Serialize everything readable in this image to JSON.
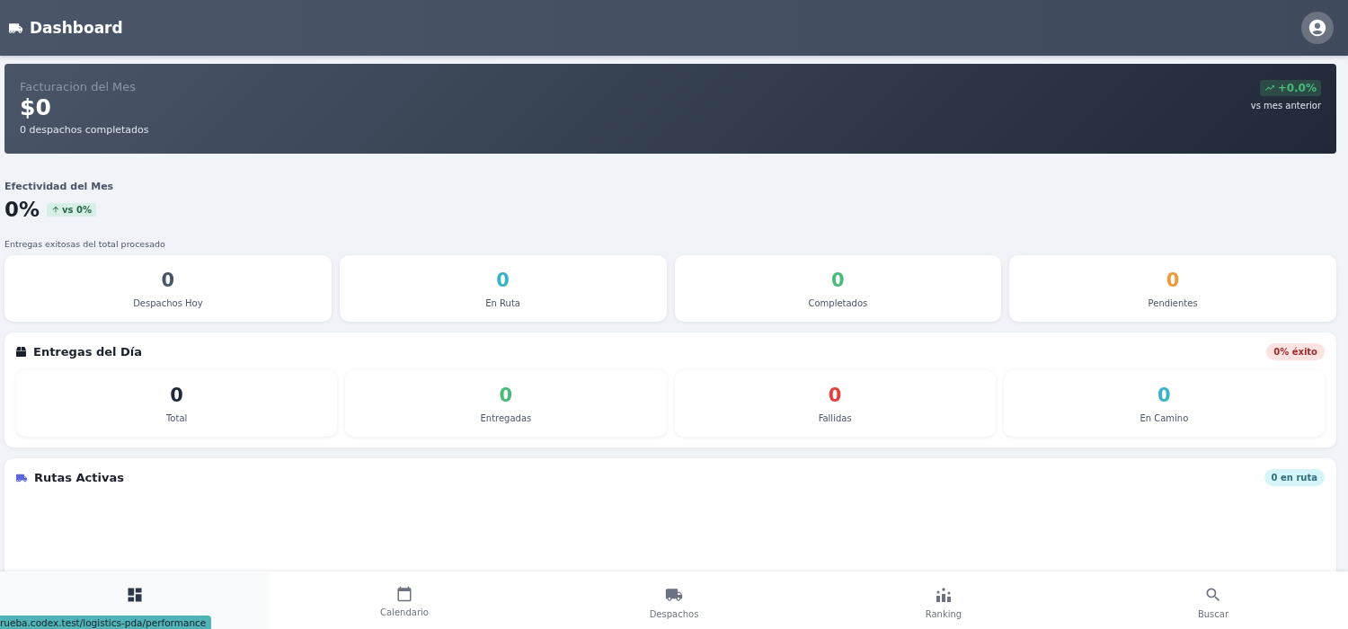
{
  "header": {
    "title": "Dashboard"
  },
  "revenue": {
    "label": "Facturacion del Mes",
    "amount": "$0",
    "subtitle": "0 despachos completados",
    "trend": "+0.0%",
    "trend_caption": "vs mes anterior"
  },
  "effectiveness": {
    "label": "Efectividad del Mes",
    "value": "0%",
    "badge": "vs 0%",
    "caption": "Entregas exitosas del total procesado"
  },
  "stats": [
    {
      "value": "0",
      "label": "Despachos Hoy",
      "color": "#475569"
    },
    {
      "value": "0",
      "label": "En Ruta",
      "color": "#38b2c8"
    },
    {
      "value": "0",
      "label": "Completados",
      "color": "#48bb78"
    },
    {
      "value": "0",
      "label": "Pendientes",
      "color": "#ed9b3a"
    }
  ],
  "deliveries": {
    "title": "Entregas del Día",
    "badge": "0% éxito",
    "items": [
      {
        "value": "0",
        "label": "Total",
        "color": "#1e293b"
      },
      {
        "value": "0",
        "label": "Entregadas",
        "color": "#48bb78"
      },
      {
        "value": "0",
        "label": "Fallidas",
        "color": "#e53e3e"
      },
      {
        "value": "0",
        "label": "En Camino",
        "color": "#38b2c8"
      }
    ]
  },
  "routes": {
    "title": "Rutas Activas",
    "badge": "0 en ruta"
  },
  "nav": [
    {
      "kind": "dashboard",
      "selected": true
    },
    {
      "kind": "calendar",
      "label": "Calendario",
      "selected": false
    },
    {
      "kind": "truck",
      "label": "Despachos",
      "selected": false
    },
    {
      "kind": "ranking",
      "label": "Ranking",
      "selected": false
    },
    {
      "kind": "search",
      "label": "Buscar",
      "selected": false
    }
  ],
  "status_url": "rueba.codex.test/logistics-pda/performance"
}
